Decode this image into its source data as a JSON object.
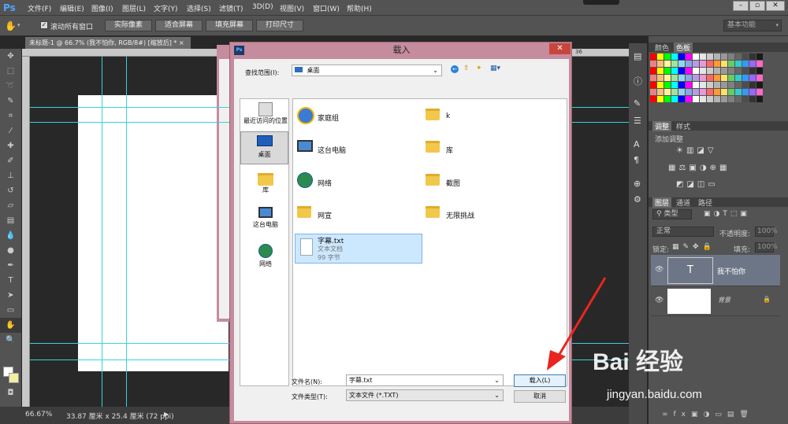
{
  "app": {
    "logo": "Ps"
  },
  "menu": [
    "文件(F)",
    "编辑(E)",
    "图像(I)",
    "图层(L)",
    "文字(Y)",
    "选择(S)",
    "滤镜(T)",
    "3D(D)",
    "视图(V)",
    "窗口(W)",
    "帮助(H)"
  ],
  "options": {
    "scroll_all_label": "滚动所有窗口",
    "btn_actual": "实际像素",
    "btn_fit": "适合屏幕",
    "btn_fill": "填充屏幕",
    "btn_print": "打印尺寸",
    "workspace": "基本功能"
  },
  "document": {
    "tab_title": "未标题-1 @ 66.7% (我不怕你, RGB/8#) [缩放后] *",
    "tab_close": "×"
  },
  "ruler": {
    "label_36": "36"
  },
  "status": {
    "zoom": "66.67%",
    "info": "33.87 厘米 x 25.4 厘米 (72 ppi)"
  },
  "panels": {
    "color_tab": "颜色",
    "swatch_tab": "色板",
    "adjust_tab": "调整",
    "style_tab": "样式",
    "adjust_hint": "添加调整",
    "layers_tab": "图层",
    "channels_tab": "通道",
    "paths_tab": "路径",
    "kind_filter": "类型",
    "blend_mode": "正常",
    "opacity_label": "不透明度:",
    "opacity_value": "100%",
    "lock_label": "锁定:",
    "fill_label": "填充:",
    "fill_value": "100%",
    "layers": [
      {
        "name": "我不怕你",
        "thumb": "T"
      },
      {
        "name": "背景",
        "lock": "🔒"
      }
    ]
  },
  "dialog": {
    "title": "载入",
    "close": "✕",
    "lookin_label": "查找范围(I):",
    "lookin_value": "桌面",
    "sidebar": [
      {
        "label": "最近访问的位置",
        "icon": "recent-places-icon"
      },
      {
        "label": "桌面",
        "icon": "desktop-icon"
      },
      {
        "label": "库",
        "icon": "libraries-icon"
      },
      {
        "label": "这台电脑",
        "icon": "computer-icon"
      },
      {
        "label": "网络",
        "icon": "network-icon"
      }
    ],
    "files": [
      {
        "name": "家庭组",
        "icon": "homegroup-icon"
      },
      {
        "name": "k",
        "icon": "user-folder-icon"
      },
      {
        "name": "这台电脑",
        "icon": "computer-icon"
      },
      {
        "name": "库",
        "icon": "libraries-icon"
      },
      {
        "name": "网络",
        "icon": "network-icon"
      },
      {
        "name": "截图",
        "icon": "folder-icon"
      },
      {
        "name": "网宣",
        "icon": "folder-icon"
      },
      {
        "name": "无限挑战",
        "icon": "folder-icon"
      }
    ],
    "selected_file": {
      "name": "字幕.txt",
      "type": "文本文档",
      "size": "99 字节"
    },
    "filename_label": "文件名(N):",
    "filename_value": "字幕.txt",
    "filetype_label": "文件类型(T):",
    "filetype_value": "文本文件 (*.TXT)",
    "load_button": "载入(L)",
    "cancel_button": "取消"
  },
  "watermark": {
    "brand": "Bai 经验",
    "url": "jingyan.baidu.com"
  },
  "colors": {
    "dialog_frame": "#c58c9e",
    "guide": "#37d4d9",
    "arrow": "#e8261f",
    "selection": "#cce8ff"
  }
}
